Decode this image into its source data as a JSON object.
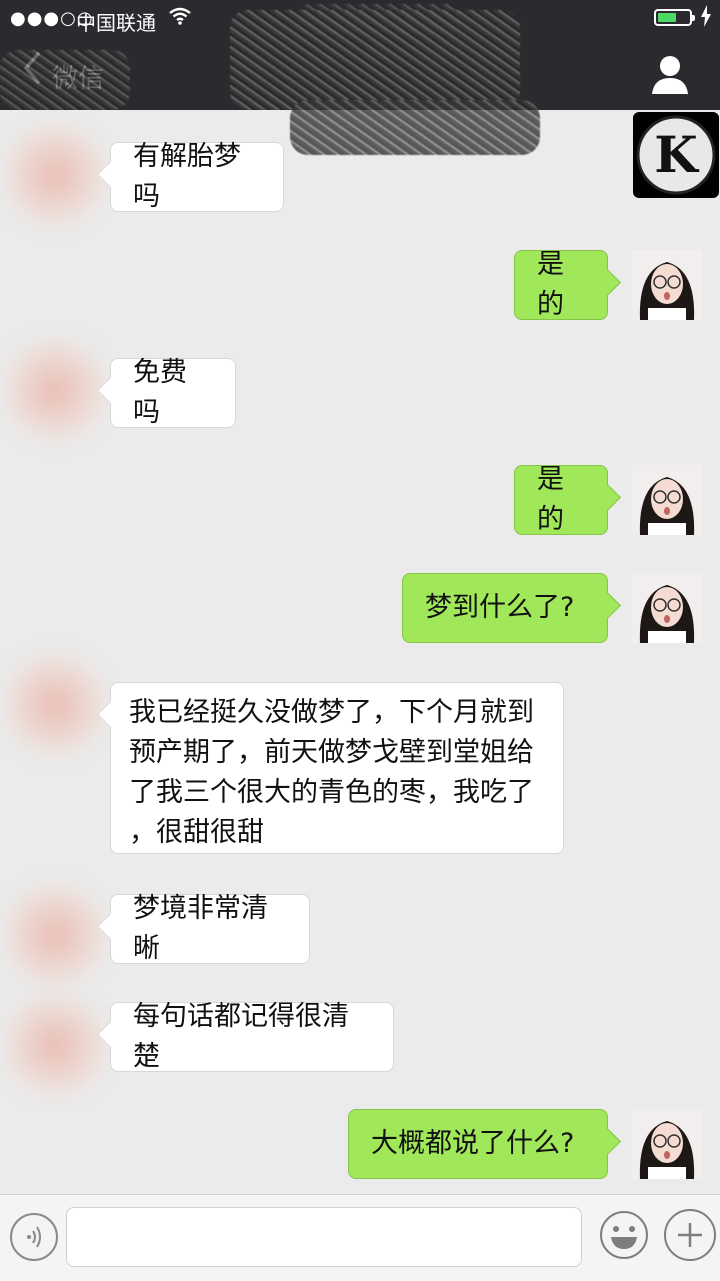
{
  "status_bar": {
    "signal": "●●●○○",
    "carrier": "中国联通",
    "battery_level": 0.6
  },
  "nav": {
    "back_label": "微信"
  },
  "messages": [
    {
      "side": "left",
      "text": "有解胎梦吗"
    },
    {
      "side": "right",
      "text": "是的"
    },
    {
      "side": "left",
      "text": "免费吗"
    },
    {
      "side": "right",
      "text": "是的"
    },
    {
      "side": "right",
      "text": "梦到什么了?"
    },
    {
      "side": "left",
      "text": "我已经挺久没做梦了，下个月就到\n预产期了，前天做梦戈壁到堂姐给\n了我三个很大的青色的枣，我吃了\n，很甜很甜"
    },
    {
      "side": "left",
      "text": "梦境非常清晰"
    },
    {
      "side": "left",
      "text": "每句话都记得很清楚"
    },
    {
      "side": "right",
      "text": "大概都说了什么?"
    }
  ],
  "logo_avatar": {
    "letter": "K"
  },
  "colors": {
    "topbar": "#2b2b2f",
    "chat_background": "#ebebeb",
    "my_bubble": "#a0e75a",
    "their_bubble": "#ffffff",
    "battery": "#4cd964"
  },
  "icons": [
    "back-chevron-icon",
    "contact-info-icon",
    "voice-icon",
    "emoji-icon",
    "plus-icon",
    "wifi-icon",
    "charging-icon"
  ]
}
